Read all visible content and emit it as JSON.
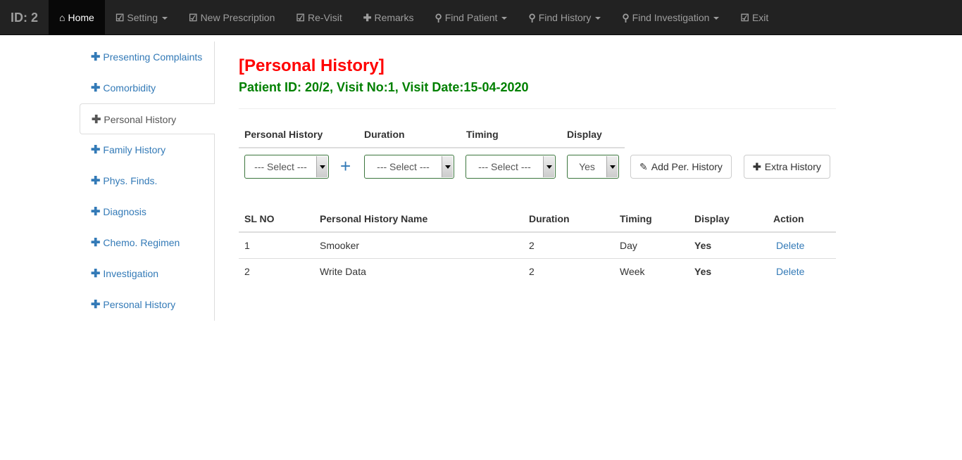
{
  "nav": {
    "brand": "ID: 2",
    "items": [
      {
        "label": "Home",
        "icon": "home-icon",
        "glyph": "⌂",
        "caret": false
      },
      {
        "label": "Setting",
        "icon": "edit-icon",
        "glyph": "☑",
        "caret": true
      },
      {
        "label": "New Prescription",
        "icon": "edit-icon",
        "glyph": "☑",
        "caret": false
      },
      {
        "label": "Re-Visit",
        "icon": "edit-icon",
        "glyph": "☑",
        "caret": false
      },
      {
        "label": "Remarks",
        "icon": "plus-icon",
        "glyph": "✚",
        "caret": false
      },
      {
        "label": "Find Patient",
        "icon": "search-icon",
        "glyph": "⚲",
        "caret": true
      },
      {
        "label": "Find History",
        "icon": "search-icon",
        "glyph": "⚲",
        "caret": true
      },
      {
        "label": "Find Investigation",
        "icon": "search-icon",
        "glyph": "⚲",
        "caret": true
      },
      {
        "label": "Exit",
        "icon": "edit-icon",
        "glyph": "☑",
        "caret": false
      }
    ]
  },
  "sidebar": {
    "items": [
      "Presenting Complaints",
      "Comorbidity",
      "Personal History",
      "Family History",
      "Phys. Finds.",
      "Diagnosis",
      "Chemo. Regimen",
      "Investigation",
      "Personal History"
    ],
    "active": 2
  },
  "main": {
    "title": "[Personal History]",
    "subtitle": "Patient ID: 20/2,  Visit No:1, Visit Date:15-04-2020",
    "form": {
      "labels": [
        "Personal History",
        "Duration",
        "Timing",
        "Display"
      ],
      "personal_history": "--- Select ---",
      "duration": "--- Select ---",
      "timing": "--- Select ---",
      "display": "Yes",
      "add_plus": "+",
      "add_button": "Add Per. History",
      "extra_button": "Extra History"
    },
    "table": {
      "headers": [
        "SL NO",
        "Personal History Name",
        "Duration",
        "Timing",
        "Display",
        "Action"
      ],
      "rows": [
        [
          "1",
          "Smooker",
          "2",
          "Day",
          "Yes",
          "Delete"
        ],
        [
          "2",
          "Write Data",
          "2",
          "Week",
          "Yes",
          "Delete"
        ]
      ]
    }
  }
}
